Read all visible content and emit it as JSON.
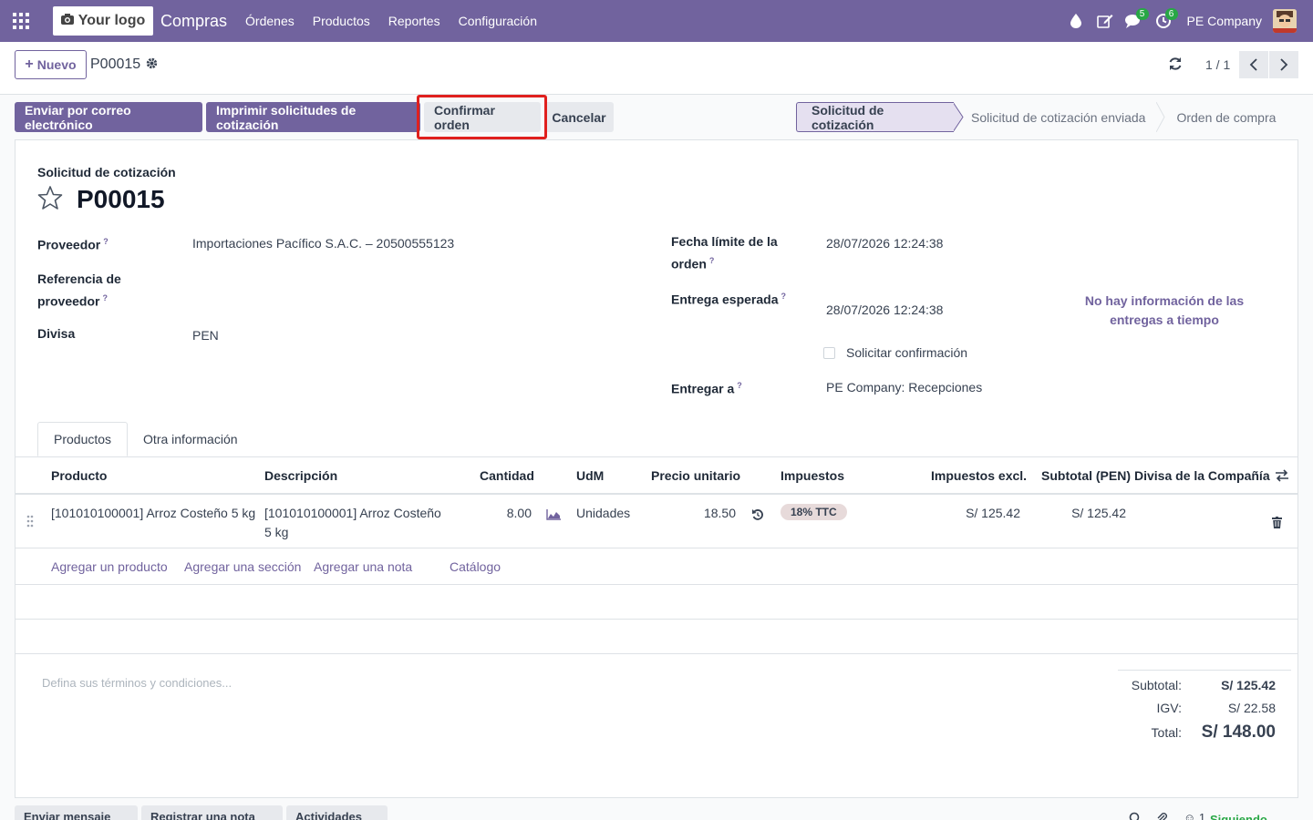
{
  "navbar": {
    "logo_text": "Your logo",
    "app_name": "Compras",
    "menu": [
      "Órdenes",
      "Productos",
      "Reportes",
      "Configuración"
    ],
    "messages_badge": "5",
    "activities_badge": "6",
    "company": "PE Company"
  },
  "control": {
    "new_label": "Nuevo",
    "record_name": "P00015",
    "pager": "1 / 1"
  },
  "actions": {
    "send_email": "Enviar por correo electrónico",
    "print_rfq": "Imprimir solicitudes de cotización",
    "confirm": "Confirmar orden",
    "cancel": "Cancelar"
  },
  "stages": [
    "Solicitud de cotización",
    "Solicitud de cotización enviada",
    "Orden de compra"
  ],
  "form": {
    "doc_type": "Solicitud de cotización",
    "name": "P00015",
    "vendor_label": "Proveedor",
    "vendor_value": "Importaciones Pacífico S.A.C. – 20500555123",
    "vendor_ref_label_1": "Referencia de",
    "vendor_ref_label_2": "proveedor",
    "currency_label": "Divisa",
    "currency_value": "PEN",
    "deadline_label_1": "Fecha límite de la",
    "deadline_label_2": "orden",
    "deadline_value": "28/07/2026 12:24:38",
    "expected_label": "Entrega esperada",
    "expected_value": "28/07/2026 12:24:38",
    "ontime_line1": "No hay información de las",
    "ontime_line2": "entregas a tiempo",
    "ask_confirm_label": "Solicitar confirmación",
    "deliver_to_label": "Entregar a",
    "deliver_to_value": "PE Company: Recepciones"
  },
  "tabs": [
    "Productos",
    "Otra información"
  ],
  "table": {
    "headers": {
      "product": "Producto",
      "description": "Descripción",
      "quantity": "Cantidad",
      "uom": "UdM",
      "unit_price": "Precio unitario",
      "taxes": "Impuestos",
      "tax_excl": "Impuestos excl.",
      "subtotal": "Subtotal (PEN)",
      "company_currency": "Divisa de la Compañía"
    },
    "rows": [
      {
        "product": "[101010100001] Arroz Costeño 5 kg",
        "description_1": "[101010100001] Arroz Costeño",
        "description_2": "5 kg",
        "quantity": "8.00",
        "uom": "Unidades",
        "unit_price": "18.50",
        "tax": "18% TTC",
        "tax_excl": "S/ 125.42",
        "subtotal": "S/ 125.42"
      }
    ],
    "add_product": "Agregar un producto",
    "add_section": "Agregar una sección",
    "add_note": "Agregar una nota",
    "catalog": "Catálogo"
  },
  "terms_placeholder": "Defina sus términos y condiciones...",
  "totals": {
    "subtotal_label": "Subtotal:",
    "subtotal_value": "S/ 125.42",
    "igv_label": "IGV:",
    "igv_value": "S/ 22.58",
    "total_label": "Total:",
    "total_value": "S/ 148.00"
  },
  "chatter": {
    "send_message": "Enviar mensaje",
    "log_note": "Registrar una nota",
    "activities": "Actividades",
    "followers": "1",
    "following": "Siguiendo"
  },
  "colors": {
    "brand": "#71639e",
    "highlight": "#e0201e",
    "badge": "#28a745"
  }
}
